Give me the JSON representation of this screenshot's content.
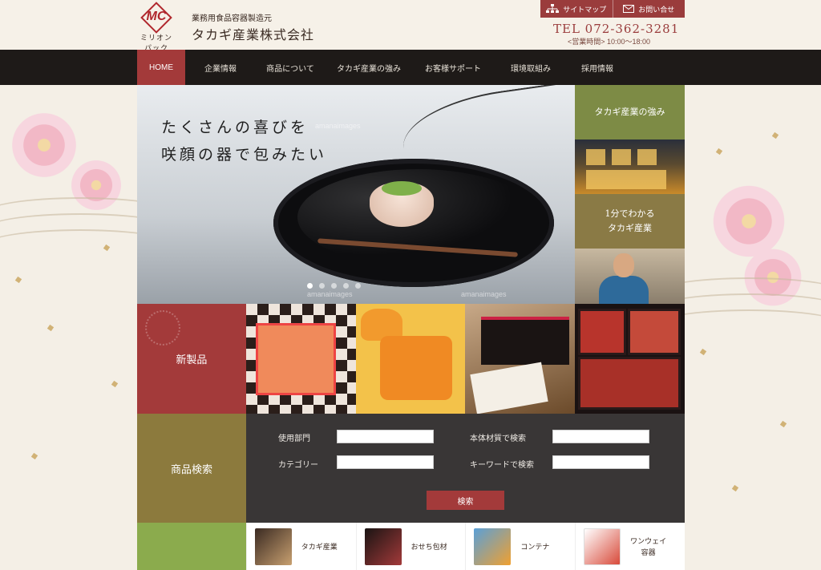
{
  "header": {
    "logo_text": "MC",
    "logo_sub": "ミリオンパック",
    "tagline": "業務用食品容器製造元",
    "company": "タカギ産業株式会社",
    "sitemap": "サイトマップ",
    "contact": "お問い合せ",
    "tel": "TEL 072-362-3281",
    "hours": "<営業時間> 10:00～18:00"
  },
  "nav": [
    {
      "label": "HOME",
      "active": true
    },
    {
      "label": "企業情報"
    },
    {
      "label": "商品について"
    },
    {
      "label": "タカギ産業の強み"
    },
    {
      "label": "お客様サポート"
    },
    {
      "label": "環境取組み"
    },
    {
      "label": "採用情報"
    }
  ],
  "hero": {
    "line1": "たくさんの喜びを",
    "line2": "咲顔の器で包みたい",
    "watermark": "amanaimages",
    "slides": 5,
    "active_slide": 0
  },
  "side": {
    "strength": "タカギ産業の強み",
    "intro_line1": "1分でわかる",
    "intro_line2": "タカギ産業"
  },
  "products": {
    "new_label": "新製品"
  },
  "search": {
    "title": "商品検索",
    "dept_label": "使用部門",
    "material_label": "本体材質で検索",
    "category_label": "カテゴリー",
    "keyword_label": "キーワードで検索",
    "button": "検索"
  },
  "bottom": [
    {
      "label": "タカギ産業",
      "icon": "bento-tray-icon"
    },
    {
      "label": "おせち包材",
      "icon": "osechi-box-icon"
    },
    {
      "label": "コンテナ",
      "icon": "container-icon"
    },
    {
      "label1": "ワンウェイ",
      "label2": "容器",
      "icon": "oneway-container-icon"
    }
  ],
  "colors": {
    "accent_red": "#a33a3a",
    "nav_bg": "#1e1a18",
    "olive": "#8c7a3d",
    "green": "#7d8b45",
    "form_bg": "#393636"
  }
}
